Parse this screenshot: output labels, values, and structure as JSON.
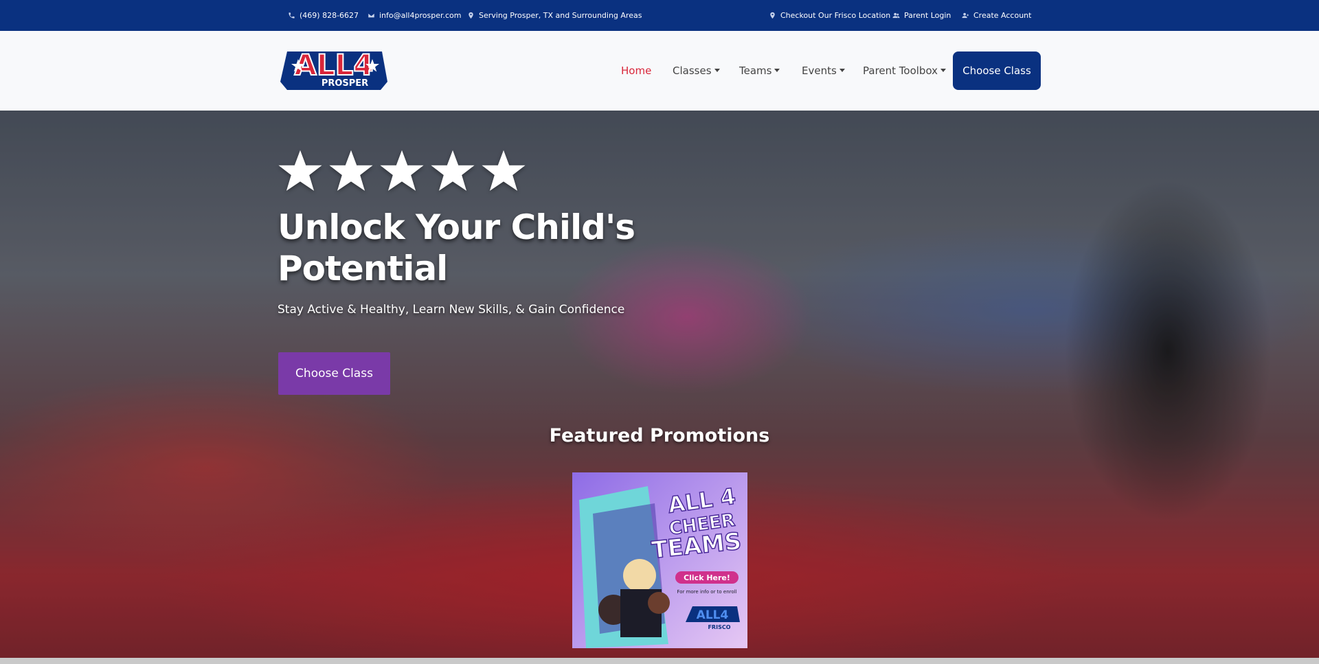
{
  "topbar": {
    "phone": "(469) 828-6627",
    "email": "info@all4prosper.com",
    "service_area": "Serving Prosper, TX and Surrounding Areas",
    "frisco_link": "Checkout Our Frisco Location",
    "parent_login": "Parent Login",
    "create_account": "Create Account"
  },
  "logo": {
    "main": "ALL4",
    "sub": "PROSPER"
  },
  "nav": {
    "home": "Home",
    "classes": "Classes",
    "teams": "Teams",
    "events": "Events",
    "parent_toolbox": "Parent Toolbox",
    "cta": "Choose Class"
  },
  "hero": {
    "rating_stars": 5,
    "title": "Unlock Your Child's Potential",
    "subtitle": "Stay Active & Healthy, Learn New Skills, & Gain Confidence",
    "cta": "Choose Class"
  },
  "promotions": {
    "heading": "Featured Promotions",
    "card": {
      "title_line1": "ALL 4",
      "title_line2": "CHEER",
      "title_line3": "TEAMS",
      "button": "Click Here!",
      "note": "For more info or to enroll",
      "logo_main": "ALL4",
      "logo_sub": "FRISCO"
    }
  },
  "colors": {
    "topbar": "#0a3180",
    "nav_active": "#d9263a",
    "hero_cta": "#7a3aa8",
    "promo_bg": "#c7a6f0"
  }
}
